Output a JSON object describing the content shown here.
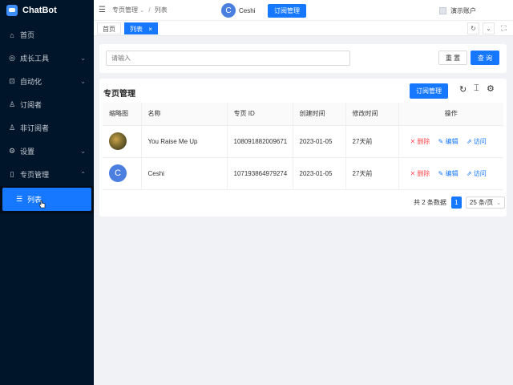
{
  "app": {
    "name": "ChatBot"
  },
  "sidebar": {
    "items": [
      {
        "label": "首页",
        "icon": "home-icon",
        "glyph": "⌂",
        "chev": ""
      },
      {
        "label": "成长工具",
        "icon": "growth-icon",
        "glyph": "◎",
        "chev": "⌄"
      },
      {
        "label": "自动化",
        "icon": "automation-icon",
        "glyph": "⊡",
        "chev": "⌄"
      },
      {
        "label": "订阅者",
        "icon": "subscriber-icon",
        "glyph": "♙",
        "chev": ""
      },
      {
        "label": "非订阅者",
        "icon": "non-subscriber-icon",
        "glyph": "♙",
        "chev": ""
      },
      {
        "label": "设置",
        "icon": "settings-icon",
        "glyph": "⚙",
        "chev": "⌄"
      },
      {
        "label": "专页管理",
        "icon": "page-icon",
        "glyph": "▯",
        "chev": "⌃"
      }
    ],
    "sub_item": {
      "label": "列表",
      "glyph": "☰"
    }
  },
  "header": {
    "breadcrumb_parent": "专页管理",
    "breadcrumb_sep": "/",
    "breadcrumb_current": "列表",
    "page_avatar": "C",
    "page_name": "Ceshi",
    "subscribe_button": "订阅管理",
    "account": "演示账户"
  },
  "tabs": {
    "home": "首页",
    "list": "列表",
    "close": "×"
  },
  "search": {
    "placeholder": "请输入",
    "reset": "重 置",
    "query": "查 询"
  },
  "table_card": {
    "title": "专页管理",
    "subscribe_button": "订阅管理",
    "columns": [
      "缩略图",
      "名称",
      "专页 ID",
      "创建时间",
      "修改时间",
      "操作"
    ],
    "rows": [
      {
        "thumb": "",
        "name": "You Raise Me Up",
        "id": "108091882009671",
        "created": "2023-01-05",
        "modified": "27天前"
      },
      {
        "thumb": "C",
        "name": "Ceshi",
        "id": "107193864979274",
        "created": "2023-01-05",
        "modified": "27天前"
      }
    ],
    "actions": {
      "delete": "删除",
      "edit": "编辑",
      "visit": "访问"
    }
  },
  "pagination": {
    "total": "共 2 条数据",
    "page": "1",
    "page_size": "25 条/页"
  }
}
